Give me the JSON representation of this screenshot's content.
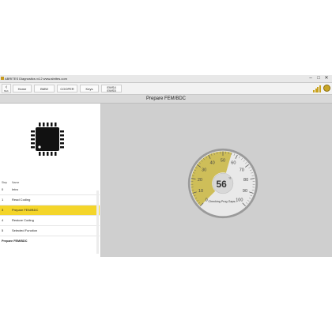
{
  "window": {
    "title": "ABRITES Diagnostics v4.2   www.abrites.com",
    "minimize": "–",
    "maximize": "□",
    "close": "✕"
  },
  "toolbar": {
    "back_label": "Back",
    "breadcrumbs": [
      "Home",
      "BMW",
      "COOPER",
      "Keys"
    ],
    "module_line1": "EWS4",
    "module_line2": "EWS5",
    "signal_icon": "signal-bars-icon",
    "logo_icon": "abrites-logo-icon"
  },
  "page": {
    "title": "Prepare FEM/BDC"
  },
  "steps": {
    "header_step": "Step",
    "header_name": "Name",
    "items": [
      {
        "num": "0",
        "name": "Intro"
      },
      {
        "num": "1",
        "name": "Read Coding"
      },
      {
        "num": "3",
        "name": "Prepare FEM/BDC",
        "active": true
      },
      {
        "num": "4",
        "name": "Restore Coding"
      },
      {
        "num": "5",
        "name": "Selected Function"
      }
    ],
    "current": "Prepare FEM/BDC"
  },
  "gauge": {
    "value": "56",
    "unit": "%",
    "status": "Checking Prog Gaps...",
    "ticks": [
      "0",
      "10",
      "20",
      "30",
      "40",
      "50",
      "60",
      "70",
      "80",
      "90",
      "100"
    ],
    "percent": 56,
    "accent": "#c9b640"
  }
}
